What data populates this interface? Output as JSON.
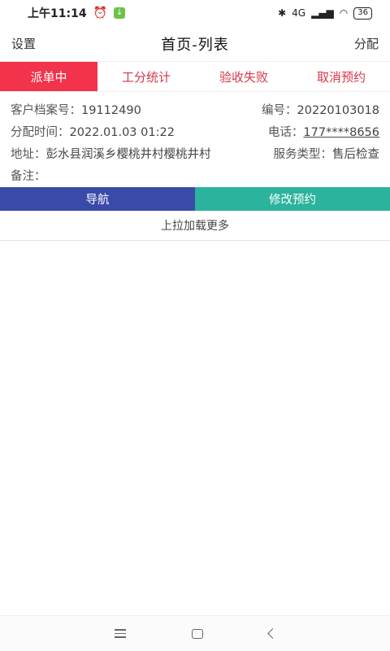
{
  "status_bar": {
    "time": "上午11:14",
    "network": "4G",
    "battery": "36"
  },
  "header": {
    "left": "设置",
    "title": "首页-列表",
    "right": "分配"
  },
  "tabs": [
    {
      "label": "派单中",
      "active": true
    },
    {
      "label": "工分统计",
      "active": false
    },
    {
      "label": "验收失败",
      "active": false
    },
    {
      "label": "取消预约",
      "active": false
    }
  ],
  "order": {
    "customer_file_label": "客户档案号：",
    "customer_file_value": "19112490",
    "number_label": "编号：",
    "number_value": "20220103018",
    "assign_time_label": "分配时间：",
    "assign_time_value": "2022.01.03 01:22",
    "phone_label": "电话：",
    "phone_value": "177****8656",
    "address_label": "地址：",
    "address_value": "彭水县润溪乡樱桃井村樱桃井村",
    "service_type_label": "服务类型：",
    "service_type_value": "售后检查",
    "remark_label": "备注：",
    "remark_value": ""
  },
  "actions": {
    "navigate": "导航",
    "modify": "修改预约"
  },
  "load_more": "上拉加载更多",
  "colors": {
    "tab_active": "#f2334b",
    "tab_text": "#d8344a",
    "navigate_button": "#3a4aa8",
    "modify_button": "#2bb39d"
  }
}
